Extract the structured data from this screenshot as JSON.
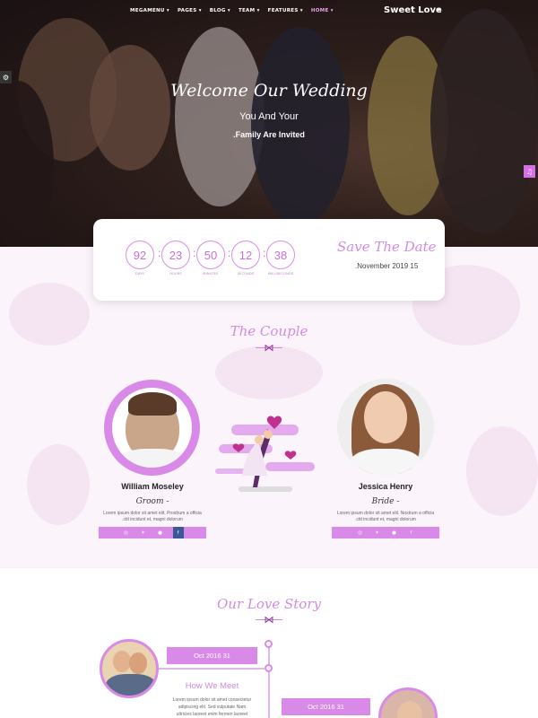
{
  "nav": {
    "items": [
      "MEGAMENU ▾",
      "PAGES ▾",
      "BLOG ▾",
      "TEAM ▾",
      "FEATURES ▾",
      "HOME ▾"
    ],
    "brand": "Sweet Love",
    "menu_icon": "hamburger-icon"
  },
  "hero": {
    "title": "Welcome Our Wedding",
    "subtitle": "You And Your",
    "subtitle2": ".Family Are Invited"
  },
  "countdown": {
    "units": [
      {
        "value": "92",
        "label": "DAYS"
      },
      {
        "value": "23",
        "label": "HOURS"
      },
      {
        "value": "50",
        "label": "MINUTES"
      },
      {
        "value": "12",
        "label": "SECONDS"
      },
      {
        "value": "38",
        "label": "MILLISECONDS"
      }
    ],
    "save_title": "Save The Date",
    "save_date": ".November 2019 15"
  },
  "couple": {
    "title": "The Couple",
    "groom": {
      "name": "William Moseley",
      "role": "Groom -",
      "desc1": "Lorem ipsum dolor sit amet elit. Proidrum a officia",
      "desc2": ".ctit incidunt et, magni dolorum"
    },
    "bride": {
      "name": "Jessica Henry",
      "role": "Bride -",
      "desc1": "Lorem ipsum dolor sit amet elit. Nostrum a officia",
      "desc2": ".ctit incidunt et, magni dolorum"
    },
    "social_icons": [
      "instagram-icon",
      "twitter-icon",
      "pinterest-icon",
      "facebook-icon"
    ]
  },
  "story": {
    "title": "Our Love Story",
    "event1": {
      "date": "Oct 2016 31",
      "heading": "How We Meet",
      "desc1": "Lorem ipsum dolor sit amet consectetur",
      "desc2": "adipiscing elit. Sed vulputate Nam",
      "desc3": "ultricies laoreet enim fermen laoreet"
    },
    "event2": {
      "date": "Oct 2016 31"
    }
  },
  "colors": {
    "accent": "#d98ae8",
    "accent_dark": "#c66fdc",
    "bow": "#8a2c8f"
  }
}
